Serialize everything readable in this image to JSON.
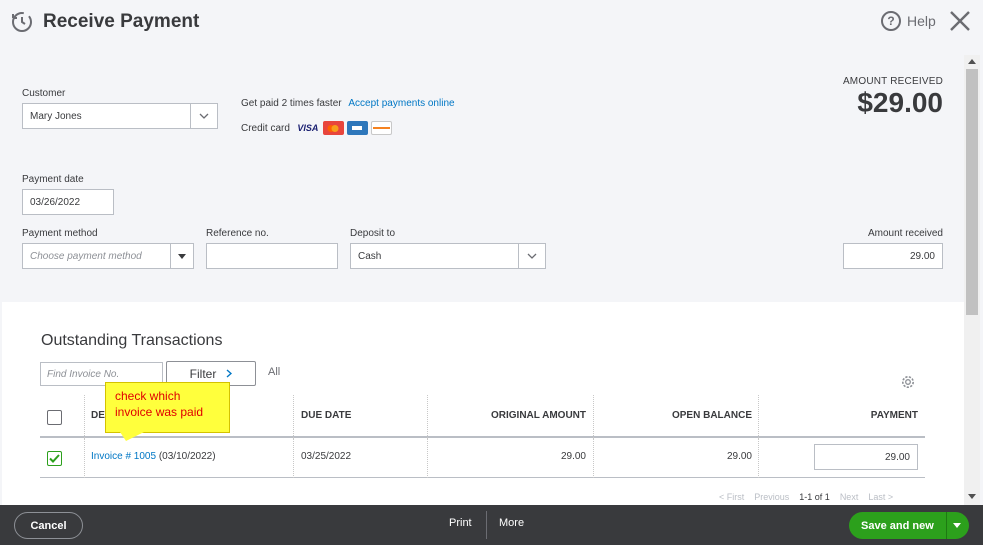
{
  "window": {
    "title": "Receive Payment",
    "help_label": "Help"
  },
  "customer": {
    "label": "Customer",
    "value": "Mary Jones"
  },
  "promo": {
    "text": "Get paid 2 times faster",
    "link": "Accept payments online",
    "credit_card_label": "Credit card",
    "cards": [
      "VISA",
      "MasterCard",
      "AMEX",
      "DISCOVER"
    ]
  },
  "amount_received_header": {
    "label": "AMOUNT RECEIVED",
    "value": "$29.00"
  },
  "payment_date": {
    "label": "Payment date",
    "value": "03/26/2022"
  },
  "payment_method": {
    "label": "Payment method",
    "placeholder": "Choose payment method"
  },
  "reference": {
    "label": "Reference no.",
    "value": ""
  },
  "deposit_to": {
    "label": "Deposit to",
    "value": "Cash"
  },
  "amount_received_field": {
    "label": "Amount received",
    "value": "29.00"
  },
  "outstanding": {
    "title": "Outstanding Transactions",
    "find_placeholder": "Find Invoice No.",
    "filter_label": "Filter",
    "all_label": "All",
    "columns": [
      "DE",
      "DUE DATE",
      "ORIGINAL AMOUNT",
      "OPEN BALANCE",
      "PAYMENT"
    ],
    "rows": [
      {
        "checked": true,
        "link": "Invoice # 1005",
        "date": "(03/10/2022)",
        "due_date": "03/25/2022",
        "original_amount": "29.00",
        "open_balance": "29.00",
        "payment": "29.00"
      }
    ]
  },
  "annotation": {
    "text": "check which invoice was paid"
  },
  "pager": {
    "first": "< First",
    "previous": "Previous",
    "range": "1-1 of 1",
    "next": "Next",
    "last": "Last >"
  },
  "footer": {
    "cancel": "Cancel",
    "print": "Print",
    "more": "More",
    "save": "Save and new"
  },
  "colors": {
    "accent": "#2ca01c",
    "link": "#0077c5",
    "footer_bg": "#393a3d",
    "callout_bg": "#ffff3c",
    "callout_text": "#e00000"
  }
}
